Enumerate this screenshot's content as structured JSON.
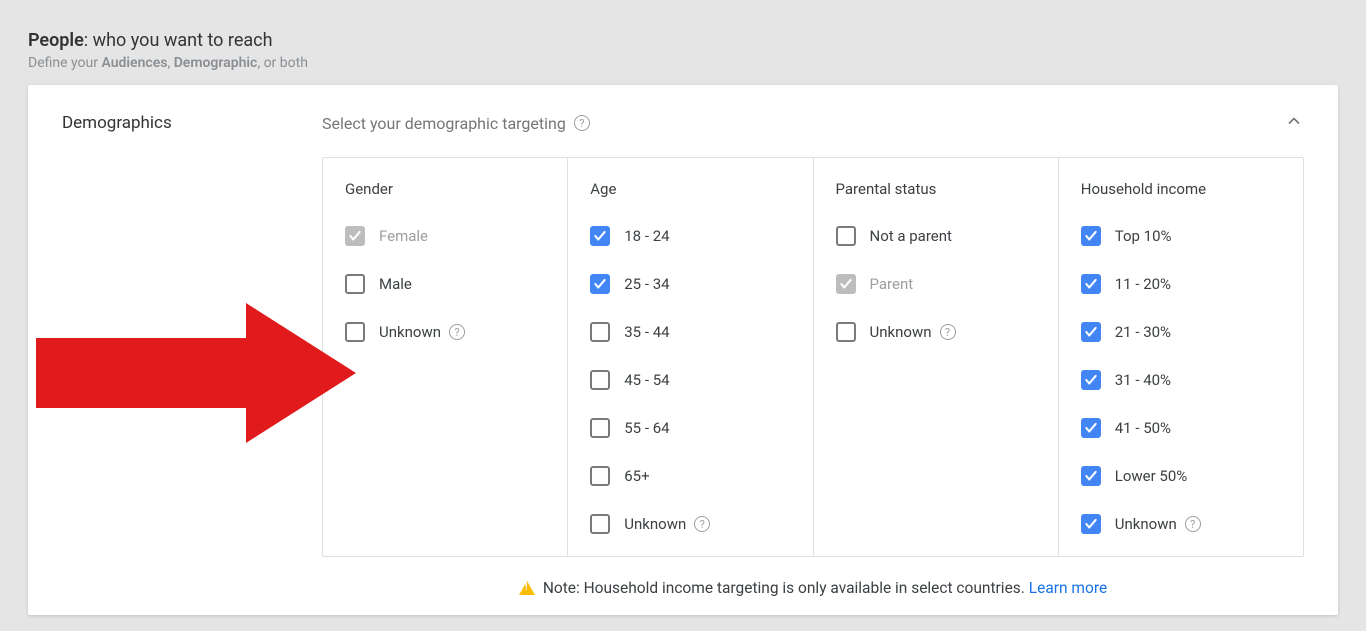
{
  "header": {
    "people_label": "People",
    "people_rest": ": who you want to reach",
    "define_prefix": "Define your ",
    "audiences": "Audiences",
    "comma": ", ",
    "demographic": "Demographic",
    "or_both": ", or both"
  },
  "card": {
    "section_title": "Demographics",
    "subheader": "Select your demographic targeting",
    "columns": [
      {
        "header": "Gender",
        "options": [
          {
            "label": "Female",
            "checked": true,
            "grey": true,
            "help": false
          },
          {
            "label": "Male",
            "checked": false,
            "grey": false,
            "help": false
          },
          {
            "label": "Unknown",
            "checked": false,
            "grey": false,
            "help": true
          }
        ]
      },
      {
        "header": "Age",
        "options": [
          {
            "label": "18 - 24",
            "checked": true,
            "grey": false,
            "help": false
          },
          {
            "label": "25 - 34",
            "checked": true,
            "grey": false,
            "help": false
          },
          {
            "label": "35 - 44",
            "checked": false,
            "grey": false,
            "help": false
          },
          {
            "label": "45 - 54",
            "checked": false,
            "grey": false,
            "help": false
          },
          {
            "label": "55 - 64",
            "checked": false,
            "grey": false,
            "help": false
          },
          {
            "label": "65+",
            "checked": false,
            "grey": false,
            "help": false
          },
          {
            "label": "Unknown",
            "checked": false,
            "grey": false,
            "help": true
          }
        ]
      },
      {
        "header": "Parental status",
        "options": [
          {
            "label": "Not a parent",
            "checked": false,
            "grey": false,
            "help": false
          },
          {
            "label": "Parent",
            "checked": true,
            "grey": true,
            "help": false
          },
          {
            "label": "Unknown",
            "checked": false,
            "grey": false,
            "help": true
          }
        ]
      },
      {
        "header": "Household income",
        "options": [
          {
            "label": "Top 10%",
            "checked": true,
            "grey": false,
            "help": false
          },
          {
            "label": "11 - 20%",
            "checked": true,
            "grey": false,
            "help": false
          },
          {
            "label": "21 - 30%",
            "checked": true,
            "grey": false,
            "help": false
          },
          {
            "label": "31 - 40%",
            "checked": true,
            "grey": false,
            "help": false
          },
          {
            "label": "41 - 50%",
            "checked": true,
            "grey": false,
            "help": false
          },
          {
            "label": "Lower 50%",
            "checked": true,
            "grey": false,
            "help": false
          },
          {
            "label": "Unknown",
            "checked": true,
            "grey": false,
            "help": true
          }
        ]
      }
    ],
    "footer_note": "Note: Household income targeting is only available in select countries.",
    "learn_more": "Learn more"
  }
}
